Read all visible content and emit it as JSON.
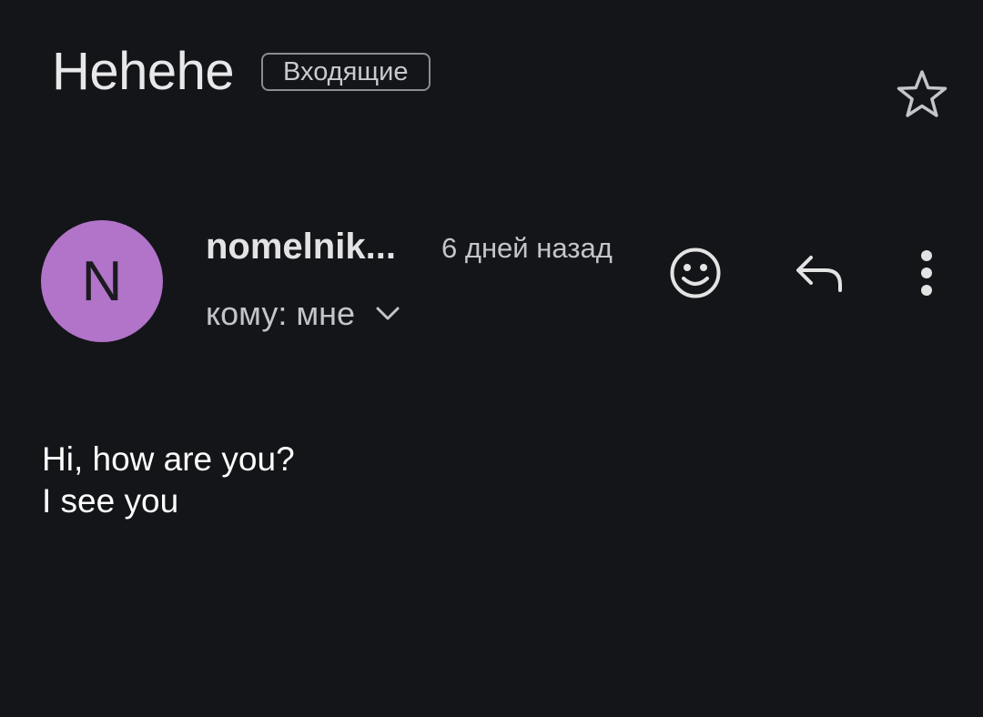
{
  "email": {
    "subject": "Hehehe",
    "label": "Входящие",
    "sender_initial": "N",
    "sender_name": "nomelnik...",
    "time": "6 дней назад",
    "recipient": "кому: мне",
    "body_lines": [
      "Hi, how are you?",
      "I see you"
    ]
  },
  "icons": {
    "star": "star-outline-icon",
    "expand": "chevron-down-icon",
    "emoji": "add-reaction-icon",
    "reply": "reply-icon",
    "more": "more-vertical-icon"
  },
  "colors": {
    "background": "#141519",
    "avatar": "#b174c9",
    "text_primary": "#e3e3e3",
    "text_secondary": "#c4c5c9"
  }
}
